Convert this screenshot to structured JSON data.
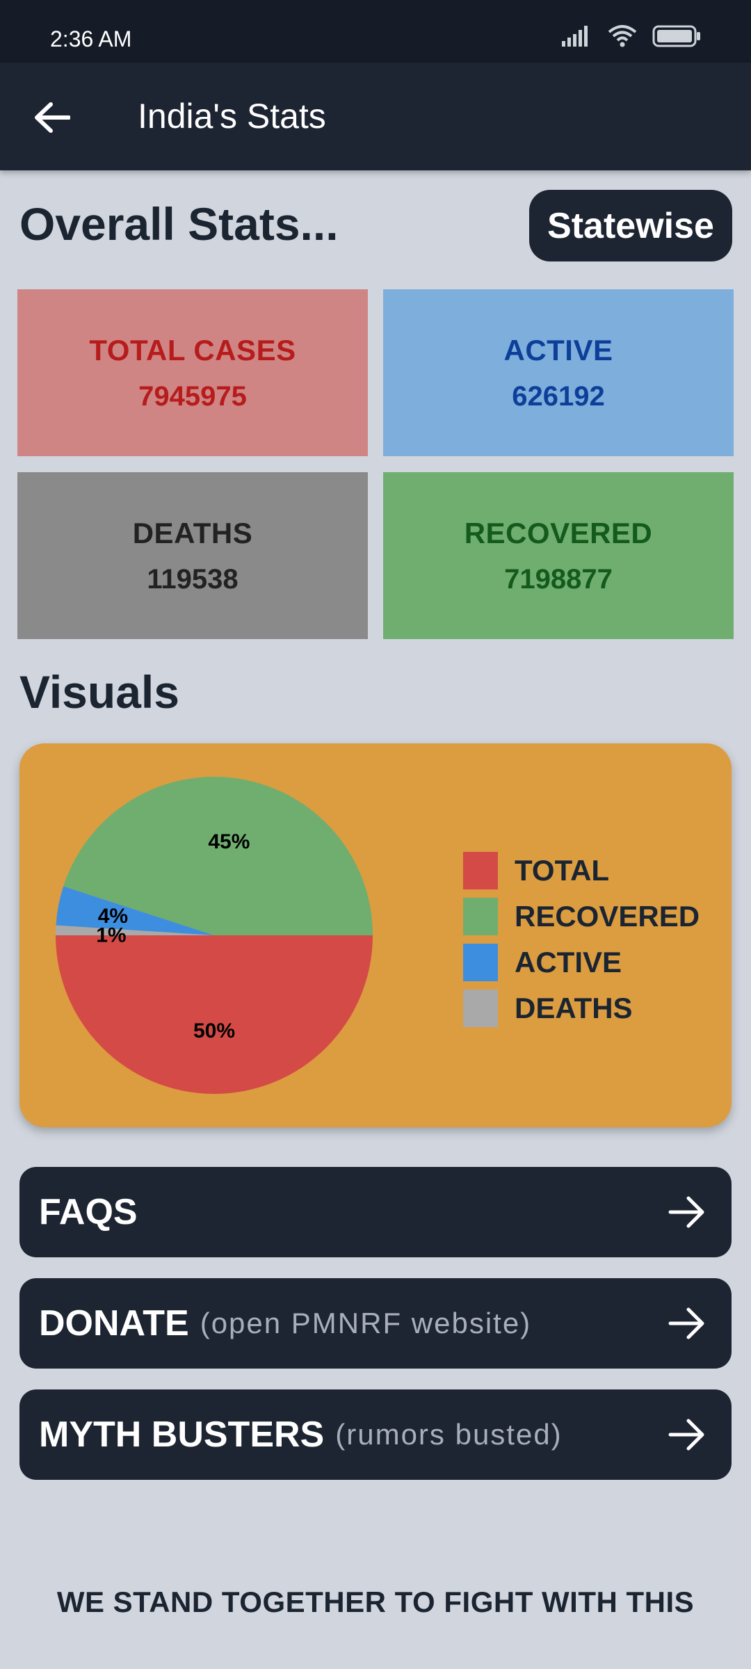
{
  "status_bar": {
    "time": "2:36 AM"
  },
  "app_bar": {
    "title": "India's Stats"
  },
  "overall": {
    "heading": "Overall Stats...",
    "statewise_label": "Statewise",
    "cards": {
      "total": {
        "label": "TOTAL CASES",
        "value": "7945975"
      },
      "active": {
        "label": "ACTIVE",
        "value": "626192"
      },
      "deaths": {
        "label": "DEATHS",
        "value": "119538"
      },
      "recovered": {
        "label": "RECOVERED",
        "value": "7198877"
      }
    }
  },
  "visuals": {
    "heading": "Visuals"
  },
  "chart_data": {
    "type": "pie",
    "title": "",
    "slices": [
      {
        "label": "TOTAL",
        "value": 50,
        "display": "50%",
        "color": "#d44a46"
      },
      {
        "label": "RECOVERED",
        "value": 45,
        "display": "45%",
        "color": "#6fae6f"
      },
      {
        "label": "ACTIVE",
        "value": 4,
        "display": "4%",
        "color": "#3e8ee0"
      },
      {
        "label": "DEATHS",
        "value": 1,
        "display": "1%",
        "color": "#a9a9a9"
      }
    ],
    "legend": [
      "TOTAL",
      "RECOVERED",
      "ACTIVE",
      "DEATHS"
    ],
    "legend_position": "right"
  },
  "nav": {
    "faqs": {
      "label": "FAQS",
      "sub": ""
    },
    "donate": {
      "label": "DONATE",
      "sub": "(open PMNRF website)"
    },
    "myth": {
      "label": "MYTH BUSTERS",
      "sub": "(rumors busted)"
    }
  },
  "footer": {
    "text": "WE STAND TOGETHER TO FIGHT WITH THIS"
  },
  "colors": {
    "background": "#d1d5de",
    "dark": "#1e2532",
    "visual_card": "#dc9c40"
  }
}
